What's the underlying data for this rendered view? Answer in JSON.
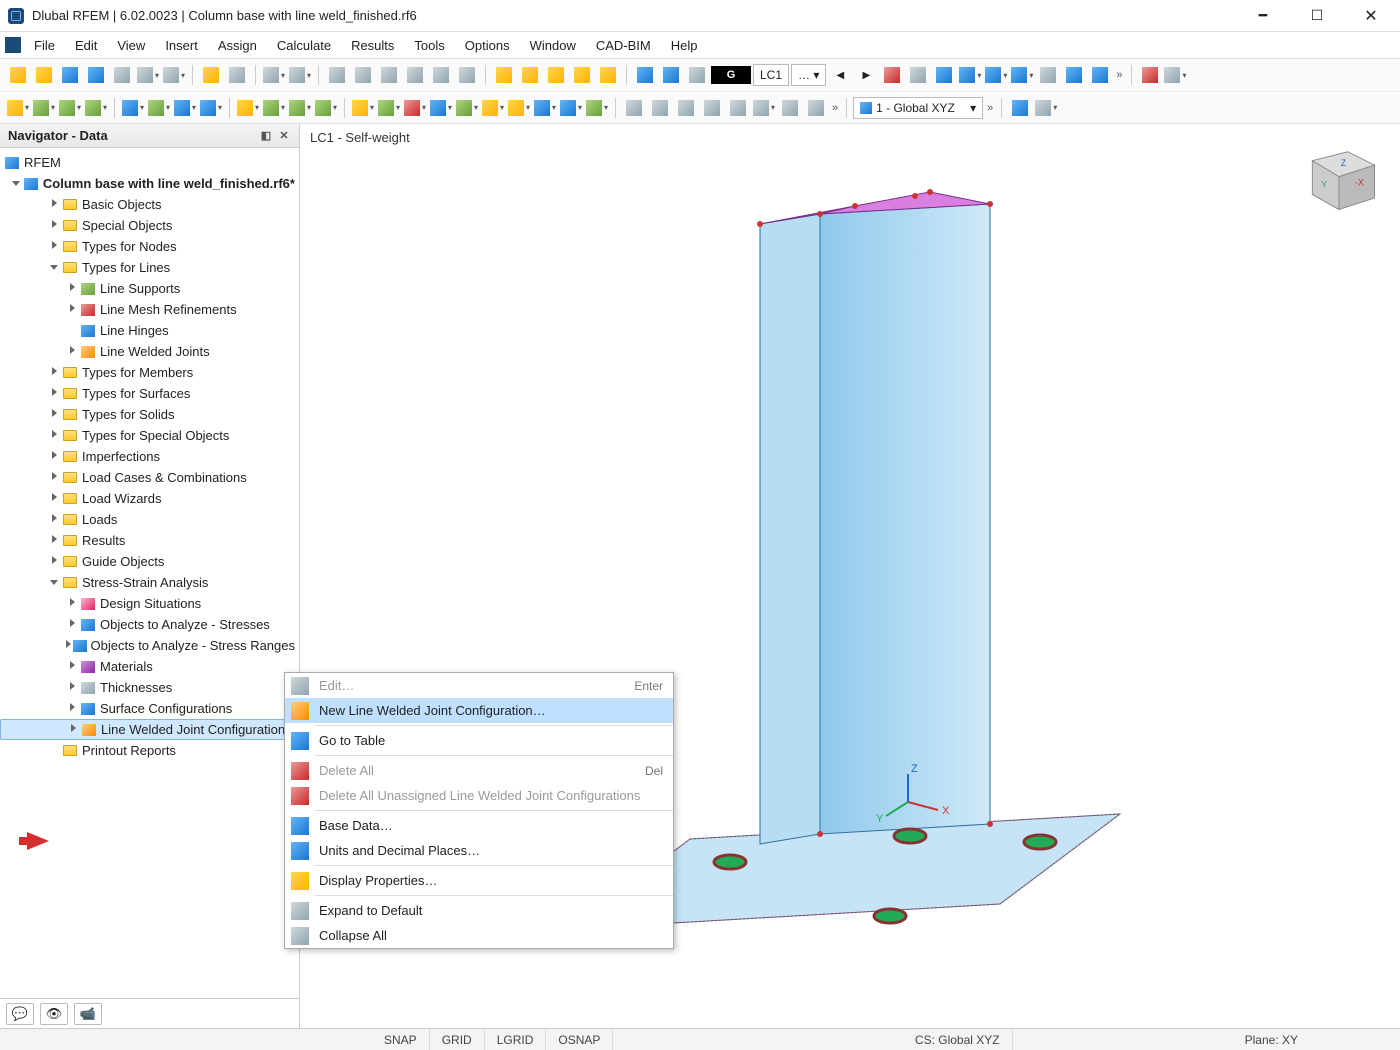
{
  "title": "Dlubal RFEM | 6.02.0023 | Column base with line weld_finished.rf6",
  "menus": [
    "File",
    "Edit",
    "View",
    "Insert",
    "Assign",
    "Calculate",
    "Results",
    "Tools",
    "Options",
    "Window",
    "CAD-BIM",
    "Help"
  ],
  "toolbar1_combo_loadset": "G",
  "toolbar1_combo_lc": "LC1",
  "toolbar1_combo_dots": "…",
  "toolbar2_combo_cs": "1 - Global XYZ",
  "navigator": {
    "title": "Navigator - Data",
    "root": "RFEM",
    "model": "Column base with line weld_finished.rf6*",
    "items": [
      {
        "lbl": "Basic Objects",
        "lvl": 2,
        "exp": "r",
        "ic": "fold"
      },
      {
        "lbl": "Special Objects",
        "lvl": 2,
        "exp": "r",
        "ic": "fold"
      },
      {
        "lbl": "Types for Nodes",
        "lvl": 2,
        "exp": "r",
        "ic": "fold"
      },
      {
        "lbl": "Types for Lines",
        "lvl": 2,
        "exp": "d",
        "ic": "fold"
      },
      {
        "lbl": "Line Supports",
        "lvl": 3,
        "exp": "r",
        "ic": "ls"
      },
      {
        "lbl": "Line Mesh Refinements",
        "lvl": 3,
        "exp": "r",
        "ic": "lm"
      },
      {
        "lbl": "Line Hinges",
        "lvl": 3,
        "exp": "",
        "ic": "lh"
      },
      {
        "lbl": "Line Welded Joints",
        "lvl": 3,
        "exp": "r",
        "ic": "lw"
      },
      {
        "lbl": "Types for Members",
        "lvl": 2,
        "exp": "r",
        "ic": "fold"
      },
      {
        "lbl": "Types for Surfaces",
        "lvl": 2,
        "exp": "r",
        "ic": "fold"
      },
      {
        "lbl": "Types for Solids",
        "lvl": 2,
        "exp": "r",
        "ic": "fold"
      },
      {
        "lbl": "Types for Special Objects",
        "lvl": 2,
        "exp": "r",
        "ic": "fold"
      },
      {
        "lbl": "Imperfections",
        "lvl": 2,
        "exp": "r",
        "ic": "fold"
      },
      {
        "lbl": "Load Cases & Combinations",
        "lvl": 2,
        "exp": "r",
        "ic": "fold"
      },
      {
        "lbl": "Load Wizards",
        "lvl": 2,
        "exp": "r",
        "ic": "fold"
      },
      {
        "lbl": "Loads",
        "lvl": 2,
        "exp": "r",
        "ic": "fold"
      },
      {
        "lbl": "Results",
        "lvl": 2,
        "exp": "r",
        "ic": "fold"
      },
      {
        "lbl": "Guide Objects",
        "lvl": 2,
        "exp": "r",
        "ic": "fold"
      },
      {
        "lbl": "Stress-Strain Analysis",
        "lvl": 2,
        "exp": "d",
        "ic": "fold"
      },
      {
        "lbl": "Design Situations",
        "lvl": 3,
        "exp": "r",
        "ic": "ds"
      },
      {
        "lbl": "Objects to Analyze - Stresses",
        "lvl": 3,
        "exp": "r",
        "ic": "oa"
      },
      {
        "lbl": "Objects to Analyze - Stress Ranges",
        "lvl": 3,
        "exp": "r",
        "ic": "oa"
      },
      {
        "lbl": "Materials",
        "lvl": 3,
        "exp": "r",
        "ic": "mat"
      },
      {
        "lbl": "Thicknesses",
        "lvl": 3,
        "exp": "r",
        "ic": "th"
      },
      {
        "lbl": "Surface Configurations",
        "lvl": 3,
        "exp": "r",
        "ic": "sc"
      },
      {
        "lbl": "Line Welded Joint Configurations",
        "lvl": 3,
        "exp": "r",
        "ic": "lwc",
        "sel": true
      },
      {
        "lbl": "Printout Reports",
        "lvl": 2,
        "exp": "",
        "ic": "fold"
      }
    ]
  },
  "viewport_label": "LC1 - Self-weight",
  "context_menu": [
    {
      "lbl": "Edit…",
      "kb": "Enter",
      "dis": true,
      "ic": "ed"
    },
    {
      "lbl": "New Line Welded Joint Configuration…",
      "hl": true,
      "ic": "new"
    },
    {
      "sep": true
    },
    {
      "lbl": "Go to Table",
      "ic": "gt"
    },
    {
      "sep": true
    },
    {
      "lbl": "Delete All",
      "kb": "Del",
      "dis": true,
      "ic": "del"
    },
    {
      "lbl": "Delete All Unassigned Line Welded Joint Configurations",
      "dis": true,
      "ic": "del2"
    },
    {
      "sep": true
    },
    {
      "lbl": "Base Data…",
      "ic": "bd"
    },
    {
      "lbl": "Units and Decimal Places…",
      "ic": "ud"
    },
    {
      "sep": true
    },
    {
      "lbl": "Display Properties…",
      "ic": "dp"
    },
    {
      "sep": true
    },
    {
      "lbl": "Expand to Default",
      "ic": "ex"
    },
    {
      "lbl": "Collapse All",
      "ic": "co"
    }
  ],
  "status": {
    "snap": "SNAP",
    "grid": "GRID",
    "lgrid": "LGRID",
    "osnap": "OSNAP",
    "cs": "CS: Global XYZ",
    "plane": "Plane: XY"
  }
}
